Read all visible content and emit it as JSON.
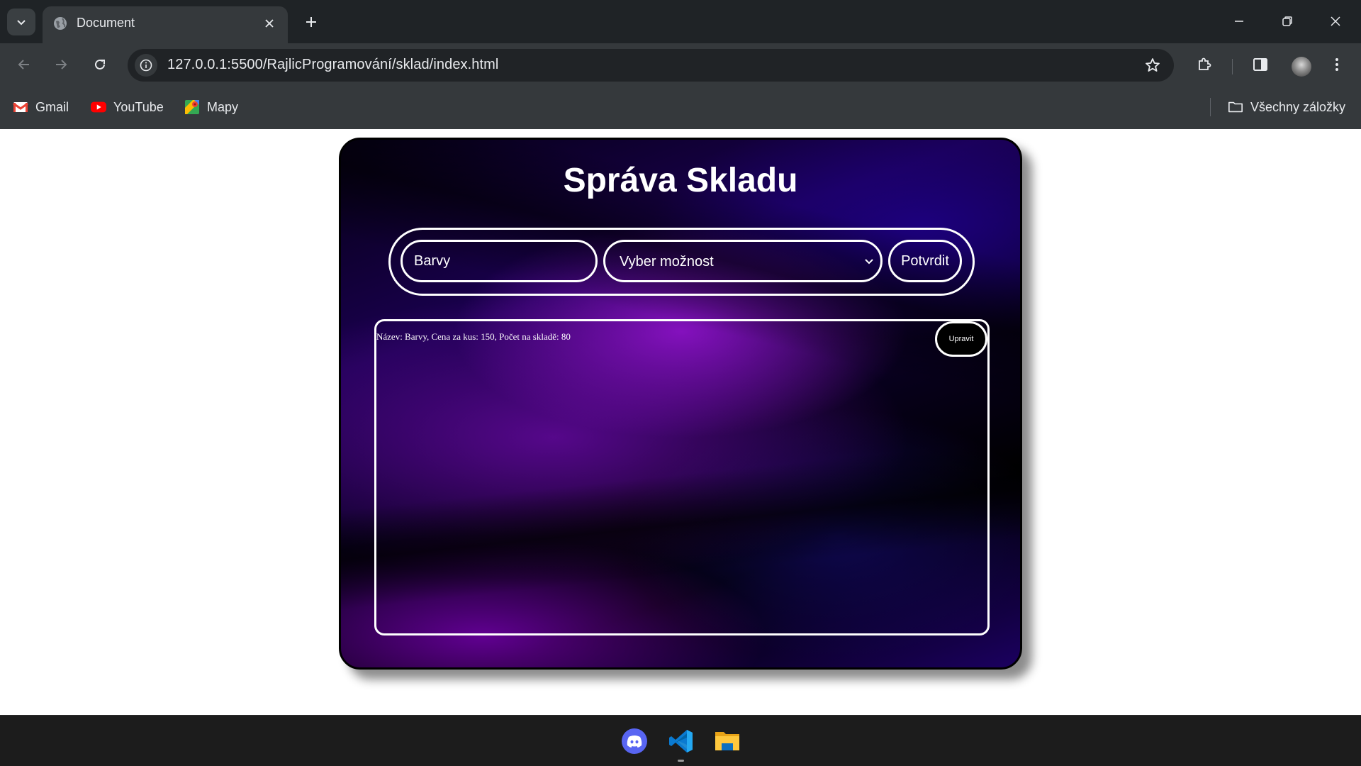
{
  "browser": {
    "tab_title": "Document",
    "url": "127.0.0.1:5500/RajlicProgramování/sklad/index.html",
    "bookmarks": [
      {
        "label": "Gmail",
        "icon": "gmail-icon"
      },
      {
        "label": "YouTube",
        "icon": "youtube-icon"
      },
      {
        "label": "Mapy",
        "icon": "maps-icon"
      }
    ],
    "all_bookmarks_label": "Všechny záložky"
  },
  "app": {
    "title": "Správa Skladu",
    "form": {
      "name_value": "Barvy",
      "select_value": "Vyber možnost",
      "confirm_label": "Potvrdit"
    },
    "items": [
      {
        "text": "Název: Barvy, Cena za kus: 150, Počet na skladě: 80",
        "edit_label": "Upravit"
      }
    ]
  },
  "taskbar": {
    "apps": [
      "discord-icon",
      "vscode-icon",
      "file-explorer-icon"
    ]
  },
  "colors": {
    "card_accent": "#7a10c8",
    "card_dark": "#05001a",
    "chrome_bg": "#35393c",
    "titlebar_bg": "#1f2326"
  }
}
